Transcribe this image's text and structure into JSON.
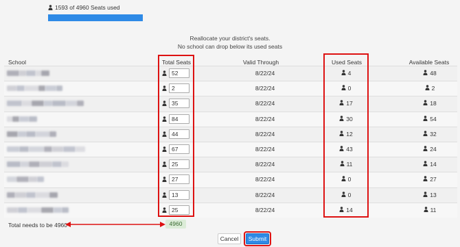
{
  "usage": {
    "text": "1593 of 4960 Seats used",
    "used": 1593,
    "total": 4960,
    "bar_fill_percent": 100,
    "bar_color": "#2e8ae6"
  },
  "instructions": {
    "line1": "Reallocate your district's seats.",
    "line2": "No school can drop below its used seats"
  },
  "table": {
    "headers": {
      "school": "School",
      "total": "Total Seats",
      "valid": "Valid Through",
      "used": "Used Seats",
      "available": "Available Seats"
    },
    "rows": [
      {
        "total": "52",
        "valid": "8/22/24",
        "used": "4",
        "available": "48"
      },
      {
        "total": "2",
        "valid": "8/22/24",
        "used": "0",
        "available": "2"
      },
      {
        "total": "35",
        "valid": "8/22/24",
        "used": "17",
        "available": "18"
      },
      {
        "total": "84",
        "valid": "8/22/24",
        "used": "30",
        "available": "54"
      },
      {
        "total": "44",
        "valid": "8/22/24",
        "used": "12",
        "available": "32"
      },
      {
        "total": "67",
        "valid": "8/22/24",
        "used": "43",
        "available": "24"
      },
      {
        "total": "25",
        "valid": "8/22/24",
        "used": "11",
        "available": "14"
      },
      {
        "total": "27",
        "valid": "8/22/24",
        "used": "0",
        "available": "27"
      },
      {
        "total": "13",
        "valid": "8/22/24",
        "used": "0",
        "available": "13"
      },
      {
        "total": "25",
        "valid": "8/22/24",
        "used": "14",
        "available": "11"
      }
    ]
  },
  "footer": {
    "label": "Total needs to be 4960",
    "total_value": "4960"
  },
  "buttons": {
    "cancel": "Cancel",
    "submit": "Submit"
  },
  "colors": {
    "highlight": "#dd1111",
    "accent": "#2e8ae6",
    "badge_bg": "#dcecd8"
  }
}
